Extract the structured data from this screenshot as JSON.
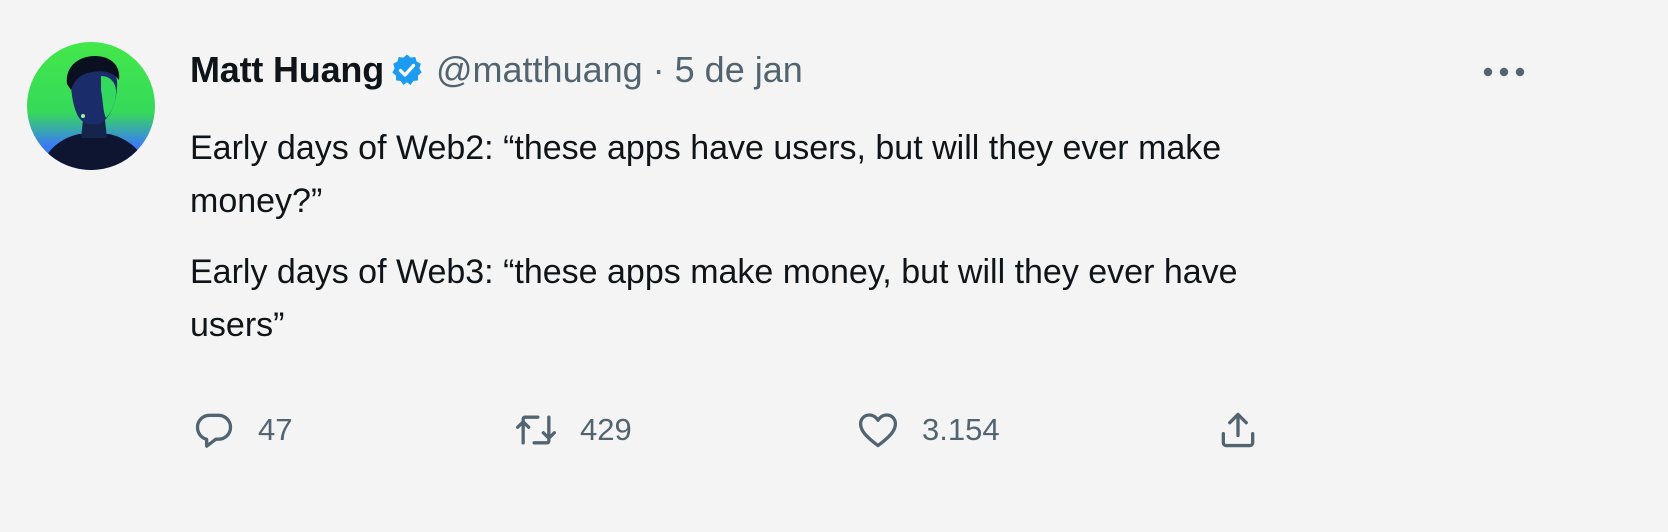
{
  "author": {
    "name": "Matt Huang",
    "handle": "@matthuang",
    "separator": "·",
    "date": "5 de jan",
    "verified": true,
    "avatar_icon": "profile-photo"
  },
  "tweet": {
    "paragraphs": [
      "Early days of Web2: “these apps have users, but will they ever make money?”",
      "Early days of Web3: “these apps make money, but will they ever have users”"
    ]
  },
  "actions": {
    "reply": {
      "icon": "reply-icon",
      "count": "47"
    },
    "retweet": {
      "icon": "retweet-icon",
      "count": "429"
    },
    "like": {
      "icon": "heart-icon",
      "count": "3.154"
    },
    "share": {
      "icon": "share-icon"
    }
  },
  "menu": {
    "icon": "more-options-icon"
  },
  "colors": {
    "background": "#f4f4f4",
    "text": "#0f1419",
    "secondary_text": "#536471",
    "verified_blue": "#1d9bf0",
    "avatar_green": "#3fe24a",
    "avatar_blue": "#3a5bf0"
  }
}
